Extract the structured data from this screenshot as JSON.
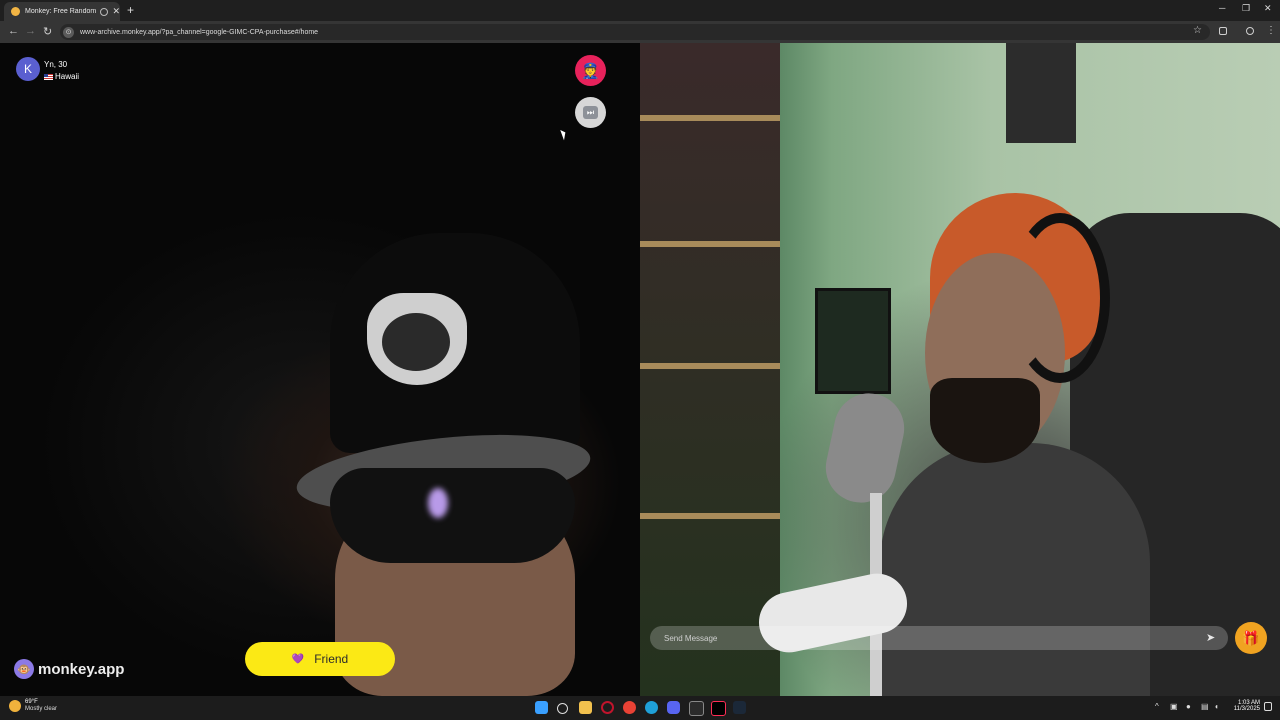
{
  "browser": {
    "tab_title": "Monkey: Free Random Video Chat",
    "url": "www-archive.monkey.app/?pa_channel=google-GIMC-CPA-purchase#/home",
    "new_tab_symbol": "+",
    "tab_close_symbol": "✕"
  },
  "peer": {
    "avatar_letter": "K",
    "name_age": "Yn, 30",
    "location": "Hawaii"
  },
  "brand": {
    "logo_text": "monkey.app"
  },
  "actions": {
    "friend_label": "Friend",
    "message_placeholder": "Send Message"
  },
  "taskbar": {
    "temperature": "69°F",
    "weather_desc": "Mostly clear",
    "time": "1:03 AM",
    "date": "11/3/2025"
  },
  "colors": {
    "police_button": "#e7225b",
    "friend_button": "#fbe915",
    "gift_button": "#f0a321",
    "avatar": "#5a5fd0"
  },
  "icons": [
    "police-icon",
    "skip-icon",
    "monkey-icon",
    "heart-icon",
    "send-icon",
    "gift-icon"
  ]
}
